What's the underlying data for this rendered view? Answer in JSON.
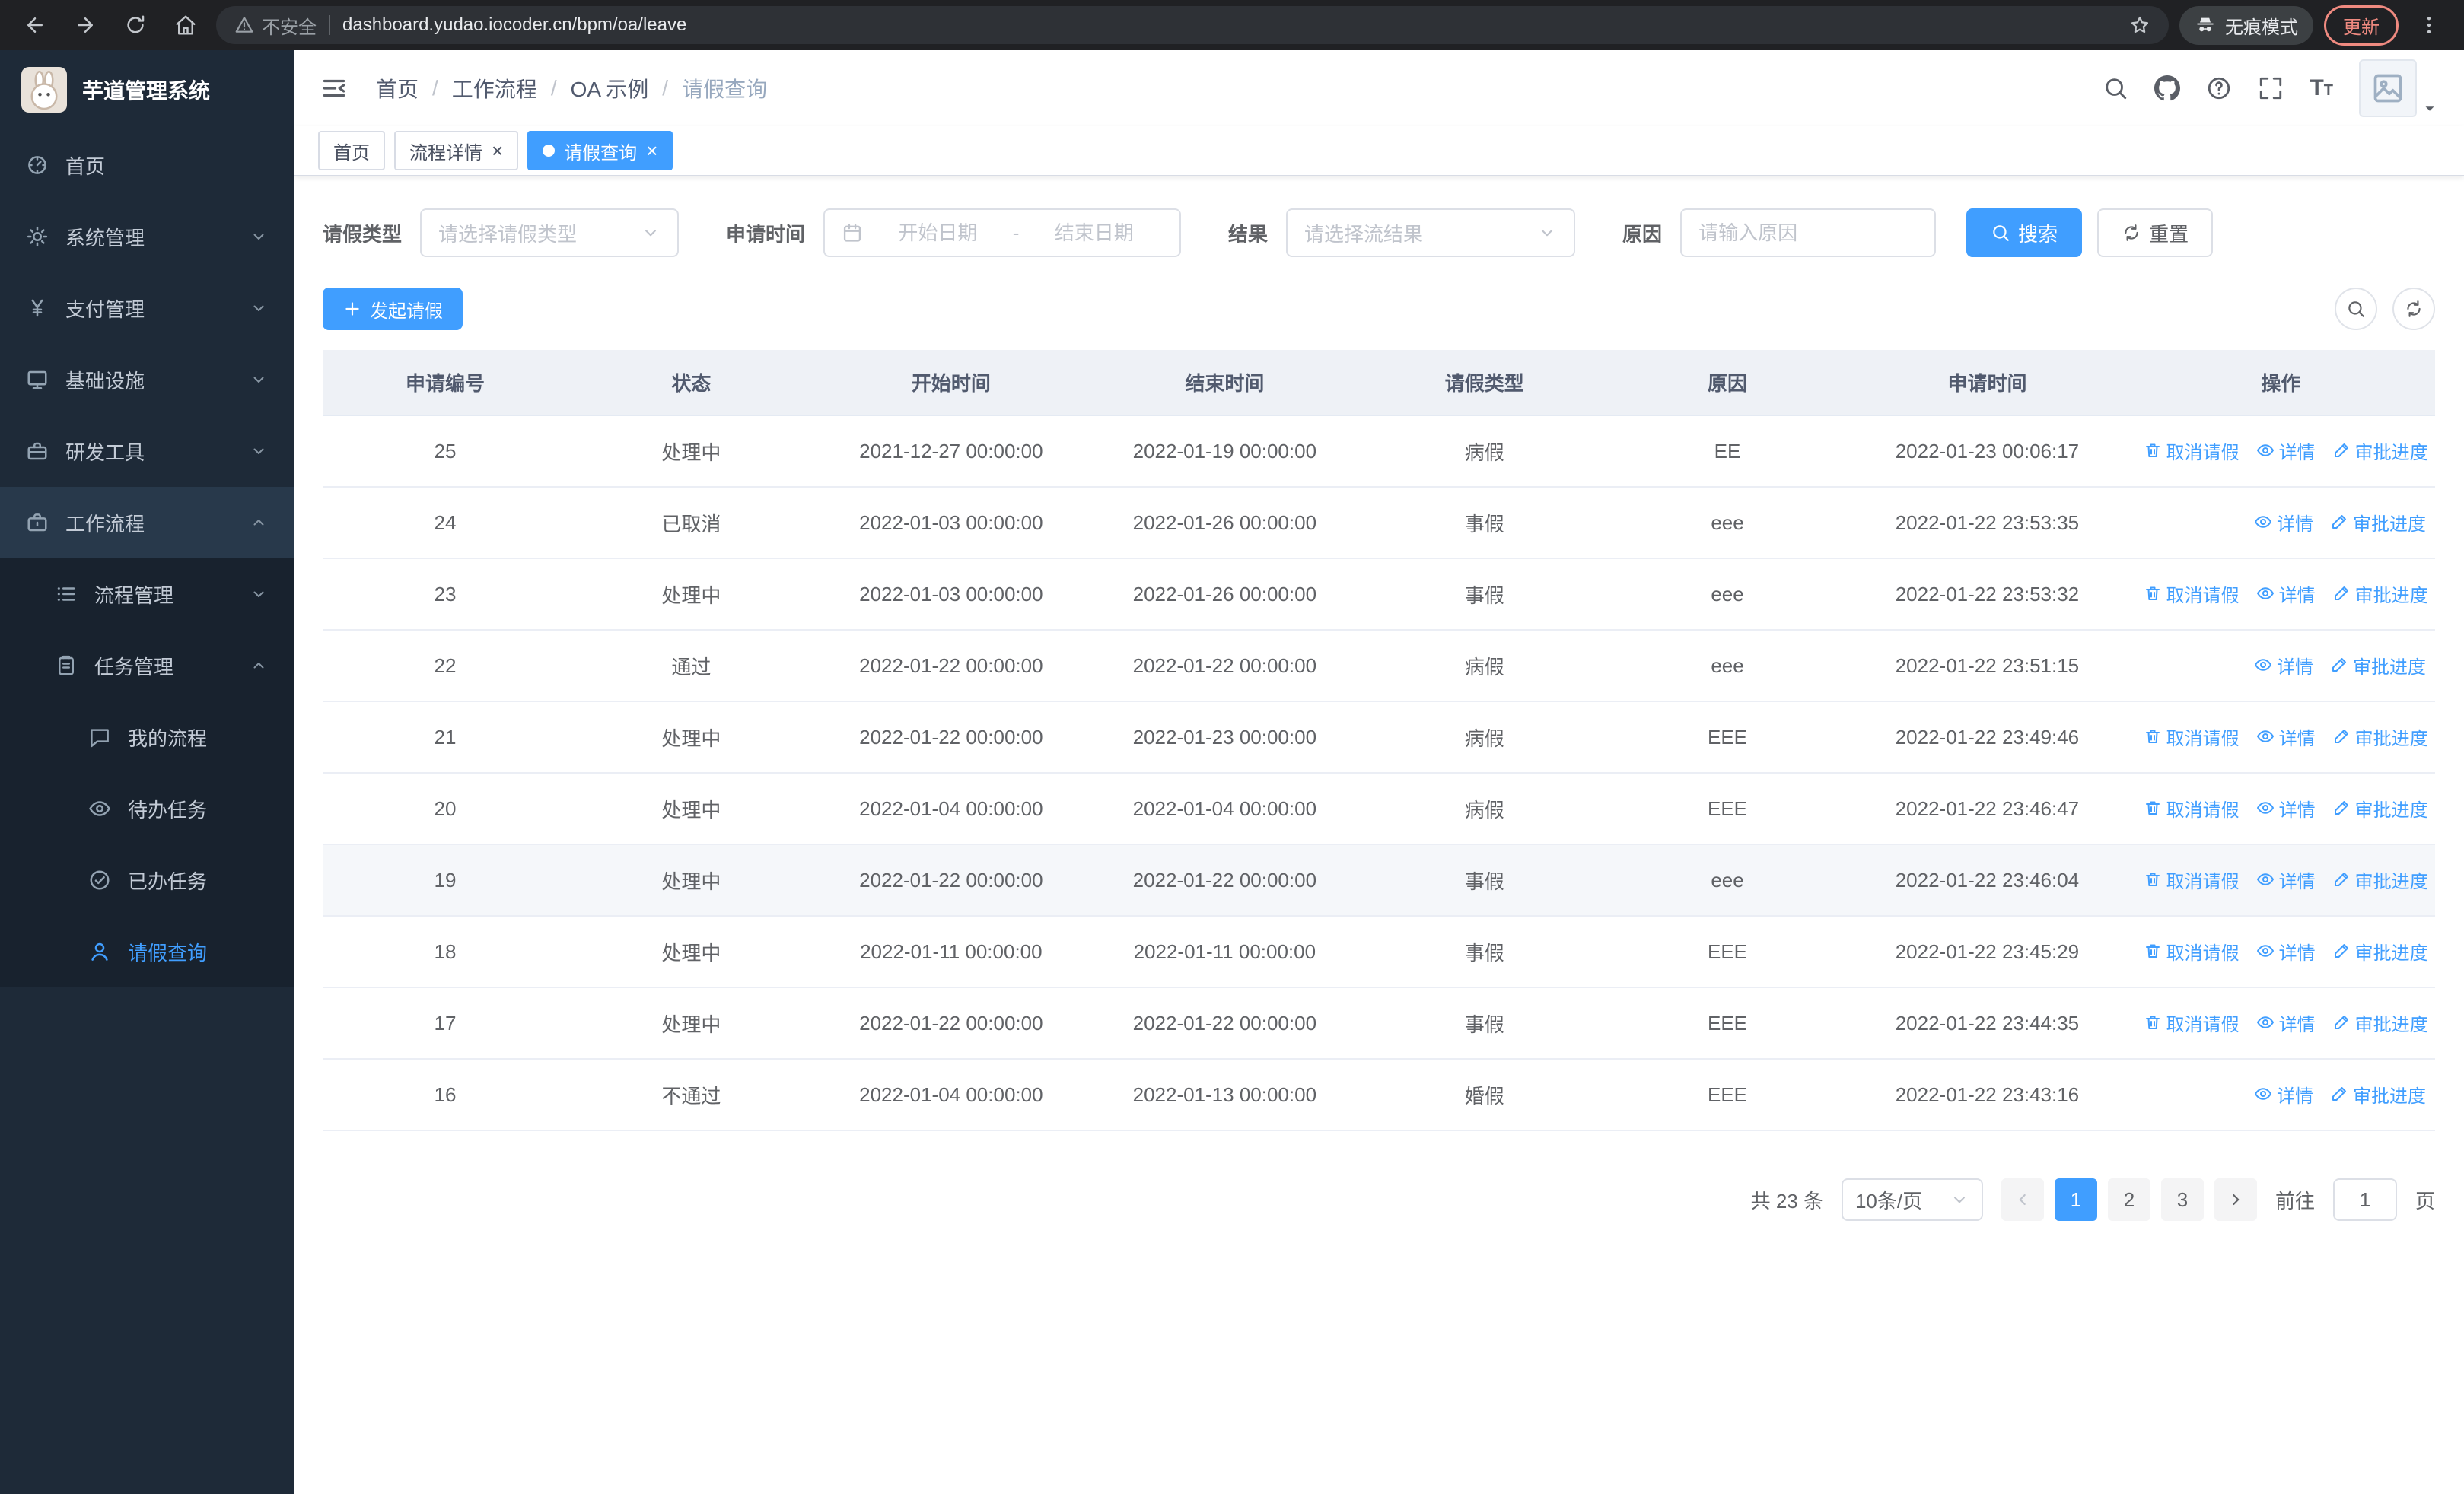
{
  "browser": {
    "security_warning": "不安全",
    "url": "dashboard.yudao.iocoder.cn/bpm/oa/leave",
    "incognito_label": "无痕模式",
    "update_label": "更新"
  },
  "sidebar": {
    "app_title": "芋道管理系统",
    "menu": [
      {
        "key": "home",
        "label": "首页",
        "icon": "dashboard-icon",
        "level": 1
      },
      {
        "key": "system",
        "label": "系统管理",
        "icon": "gear-icon",
        "level": 1,
        "chevron": "down"
      },
      {
        "key": "payment",
        "label": "支付管理",
        "icon": "yen-icon",
        "level": 1,
        "chevron": "down"
      },
      {
        "key": "infrastructure",
        "label": "基础设施",
        "icon": "monitor-icon",
        "level": 1,
        "chevron": "down"
      },
      {
        "key": "devtools",
        "label": "研发工具",
        "icon": "toolbox-icon",
        "level": 1,
        "chevron": "down"
      },
      {
        "key": "workflow",
        "label": "工作流程",
        "icon": "briefcase-icon",
        "level": 1,
        "chevron": "up",
        "highlight": true
      },
      {
        "key": "process-mgmt",
        "label": "流程管理",
        "icon": "list-icon",
        "level": 2,
        "chevron": "down"
      },
      {
        "key": "task-mgmt",
        "label": "任务管理",
        "icon": "clipboard-icon",
        "level": 2,
        "chevron": "up"
      },
      {
        "key": "my-process",
        "label": "我的流程",
        "icon": "chat-icon",
        "level": 3
      },
      {
        "key": "todo-tasks",
        "label": "待办任务",
        "icon": "eye-icon",
        "level": 3
      },
      {
        "key": "done-tasks",
        "label": "已办任务",
        "icon": "check-icon",
        "level": 3
      },
      {
        "key": "leave-query",
        "label": "请假查询",
        "icon": "user-icon",
        "level": 3,
        "active": true
      }
    ]
  },
  "header": {
    "breadcrumb": [
      "首页",
      "工作流程",
      "OA 示例",
      "请假查询"
    ]
  },
  "tabs": [
    {
      "label": "首页",
      "closable": false,
      "active": false
    },
    {
      "label": "流程详情",
      "closable": true,
      "active": false
    },
    {
      "label": "请假查询",
      "closable": true,
      "active": true
    }
  ],
  "filters": {
    "leave_type_label": "请假类型",
    "leave_type_placeholder": "请选择请假类型",
    "apply_time_label": "申请时间",
    "start_date_placeholder": "开始日期",
    "range_separator": "-",
    "end_date_placeholder": "结束日期",
    "result_label": "结果",
    "result_placeholder": "请选择流结果",
    "reason_label": "原因",
    "reason_placeholder": "请输入原因",
    "search_button": "搜索",
    "reset_button": "重置"
  },
  "toolbar": {
    "create_button": "发起请假"
  },
  "table": {
    "columns": [
      "申请编号",
      "状态",
      "开始时间",
      "结束时间",
      "请假类型",
      "原因",
      "申请时间",
      "操作"
    ],
    "action_labels": {
      "cancel": "取消请假",
      "detail": "详情",
      "progress": "审批进度"
    },
    "action_icons": {
      "cancel": "delete-icon",
      "detail": "eye-icon",
      "progress": "edit-icon"
    },
    "rows": [
      {
        "id": "25",
        "status": "处理中",
        "start": "2021-12-27 00:00:00",
        "end": "2022-01-19 00:00:00",
        "type": "病假",
        "reason": "EE",
        "applied": "2022-01-23 00:06:17",
        "actions": [
          "cancel",
          "detail",
          "progress"
        ]
      },
      {
        "id": "24",
        "status": "已取消",
        "start": "2022-01-03 00:00:00",
        "end": "2022-01-26 00:00:00",
        "type": "事假",
        "reason": "eee",
        "applied": "2022-01-22 23:53:35",
        "actions": [
          "detail",
          "progress"
        ]
      },
      {
        "id": "23",
        "status": "处理中",
        "start": "2022-01-03 00:00:00",
        "end": "2022-01-26 00:00:00",
        "type": "事假",
        "reason": "eee",
        "applied": "2022-01-22 23:53:32",
        "actions": [
          "cancel",
          "detail",
          "progress"
        ]
      },
      {
        "id": "22",
        "status": "通过",
        "start": "2022-01-22 00:00:00",
        "end": "2022-01-22 00:00:00",
        "type": "病假",
        "reason": "eee",
        "applied": "2022-01-22 23:51:15",
        "actions": [
          "detail",
          "progress"
        ]
      },
      {
        "id": "21",
        "status": "处理中",
        "start": "2022-01-22 00:00:00",
        "end": "2022-01-23 00:00:00",
        "type": "病假",
        "reason": "EEE",
        "applied": "2022-01-22 23:49:46",
        "actions": [
          "cancel",
          "detail",
          "progress"
        ]
      },
      {
        "id": "20",
        "status": "处理中",
        "start": "2022-01-04 00:00:00",
        "end": "2022-01-04 00:00:00",
        "type": "病假",
        "reason": "EEE",
        "applied": "2022-01-22 23:46:47",
        "actions": [
          "cancel",
          "detail",
          "progress"
        ]
      },
      {
        "id": "19",
        "status": "处理中",
        "start": "2022-01-22 00:00:00",
        "end": "2022-01-22 00:00:00",
        "type": "事假",
        "reason": "eee",
        "applied": "2022-01-22 23:46:04",
        "actions": [
          "cancel",
          "detail",
          "progress"
        ],
        "highlighted": true
      },
      {
        "id": "18",
        "status": "处理中",
        "start": "2022-01-11 00:00:00",
        "end": "2022-01-11 00:00:00",
        "type": "事假",
        "reason": "EEE",
        "applied": "2022-01-22 23:45:29",
        "actions": [
          "cancel",
          "detail",
          "progress"
        ]
      },
      {
        "id": "17",
        "status": "处理中",
        "start": "2022-01-22 00:00:00",
        "end": "2022-01-22 00:00:00",
        "type": "事假",
        "reason": "EEE",
        "applied": "2022-01-22 23:44:35",
        "actions": [
          "cancel",
          "detail",
          "progress"
        ]
      },
      {
        "id": "16",
        "status": "不通过",
        "start": "2022-01-04 00:00:00",
        "end": "2022-01-13 00:00:00",
        "type": "婚假",
        "reason": "EEE",
        "applied": "2022-01-22 23:43:16",
        "actions": [
          "detail",
          "progress"
        ]
      }
    ]
  },
  "pagination": {
    "total": "共 23 条",
    "page_size": "10条/页",
    "pages": [
      "1",
      "2",
      "3"
    ],
    "active_page": "1",
    "goto_label": "前往",
    "goto_value": "1",
    "goto_suffix": "页"
  }
}
